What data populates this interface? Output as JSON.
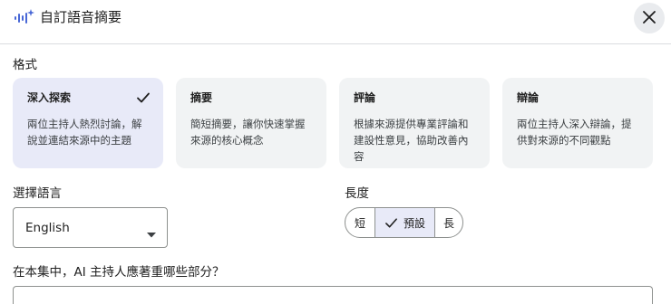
{
  "dialog": {
    "title": "自訂語音摘要",
    "icons": {
      "app": "audio-sparkle-icon",
      "close": "close-icon"
    }
  },
  "format": {
    "label": "格式",
    "options": [
      {
        "title": "深入探索",
        "description": "兩位主持人熱烈討論，解說並連結來源中的主題",
        "selected": true
      },
      {
        "title": "摘要",
        "description": "簡短摘要，讓你快速掌握來源的核心概念",
        "selected": false
      },
      {
        "title": "評論",
        "description": "根據來源提供專業評論和建設性意見，協助改善內容",
        "selected": false
      },
      {
        "title": "辯論",
        "description": "兩位主持人深入辯論，提供對來源的不同觀點",
        "selected": false
      }
    ]
  },
  "language": {
    "label": "選擇語言",
    "value": "English"
  },
  "length": {
    "label": "長度",
    "options": [
      "短",
      "預設",
      "長"
    ],
    "selected": "預設"
  },
  "focus": {
    "question": "在本集中，AI 主持人應著重哪些部分？"
  },
  "colors": {
    "accent_bg": "#e8eaf8",
    "card_bg": "#f1f3f4",
    "close_bg": "#e9ebee"
  }
}
